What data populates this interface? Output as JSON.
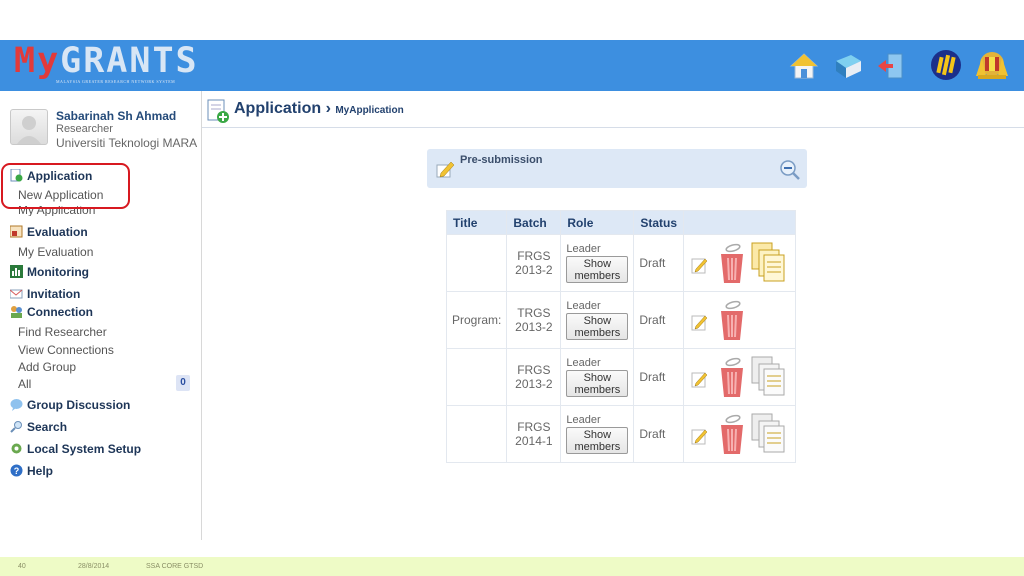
{
  "header": {
    "logo_text_my": "My",
    "logo_text_grants": "GRANTS",
    "logo_subtitle": "MALAYSIA GREATER RESEARCH NETWORK SYSTEM",
    "icons": [
      "home-icon",
      "book-icon",
      "logout-icon",
      "ministry-logo",
      "government-crest"
    ]
  },
  "user": {
    "name": "Sabarinah Sh Ahmad",
    "role": "Researcher",
    "organization": "Universiti Teknologi MARA"
  },
  "nav": {
    "application": "Application",
    "new_application": "New Application",
    "my_application": "My Application",
    "evaluation": "Evaluation",
    "my_evaluation": "My Evaluation",
    "monitoring": "Monitoring",
    "invitation": "Invitation",
    "connection": "Connection",
    "find_researcher": "Find Researcher",
    "view_connections": "View Connections",
    "add_group": "Add Group",
    "all": "All",
    "all_count": "0",
    "group_discussion": "Group Discussion",
    "search": "Search",
    "local_system_setup": "Local System Setup",
    "help": "Help"
  },
  "page": {
    "title": "Application",
    "separator": "›",
    "subtitle": "MyApplication"
  },
  "panel": {
    "label": "Pre-submission"
  },
  "table": {
    "headers": [
      "Title",
      "Batch",
      "Role",
      "Status",
      ""
    ],
    "rows": [
      {
        "title": "",
        "batch_1": "FRGS",
        "batch_2": "2013-2",
        "role": "Leader",
        "button_1": "Show",
        "button_2": "members",
        "status": "Draft"
      },
      {
        "title": "Program:",
        "batch_1": "TRGS",
        "batch_2": "2013-2",
        "role": "Leader",
        "button_1": "Show",
        "button_2": "members",
        "status": "Draft"
      },
      {
        "title": "",
        "batch_1": "FRGS",
        "batch_2": "2013-2",
        "role": "Leader",
        "button_1": "Show",
        "button_2": "members",
        "status": "Draft"
      },
      {
        "title": "",
        "batch_1": "FRGS",
        "batch_2": "2014-1",
        "role": "Leader",
        "button_1": "Show",
        "button_2": "members",
        "status": "Draft"
      }
    ]
  },
  "footer": {
    "page_number": "40",
    "date": "28/8/2014",
    "label": "SSA CORE GTSD"
  },
  "colors": {
    "header_bg": "#3d8fe0",
    "highlight": "#d71920",
    "panel_bg": "#dde8f6",
    "footer_bg": "#eefbc6"
  }
}
